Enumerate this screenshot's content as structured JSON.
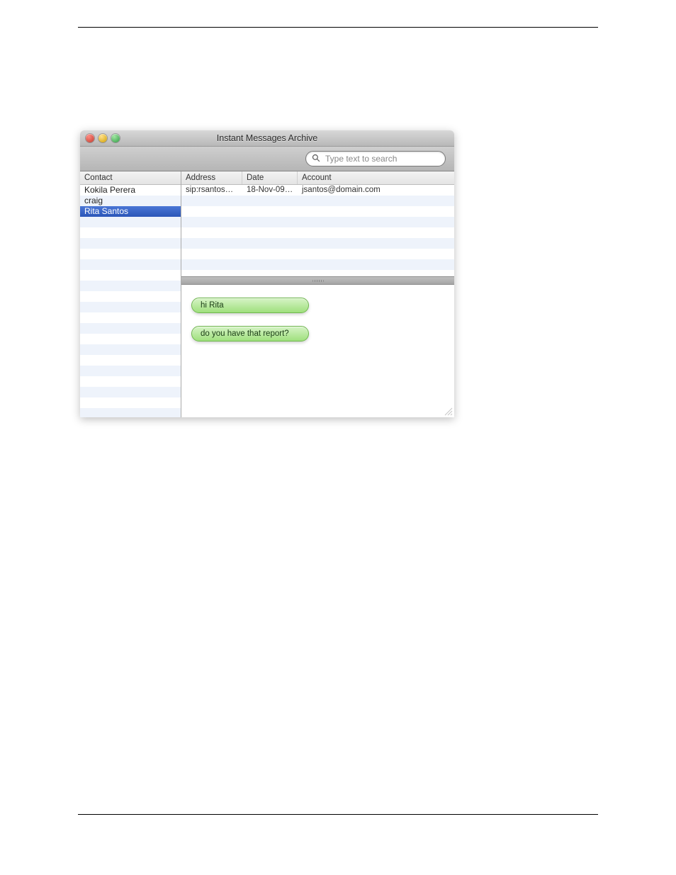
{
  "window": {
    "title": "Instant Messages Archive"
  },
  "search": {
    "placeholder": "Type text to search"
  },
  "sidebar": {
    "header": "Contact",
    "items": [
      {
        "label": "Kokila Perera",
        "selected": false
      },
      {
        "label": "craig",
        "selected": false
      },
      {
        "label": "Rita Santos",
        "selected": true
      }
    ]
  },
  "table": {
    "columns": {
      "address": "Address",
      "date": "Date",
      "account": "Account"
    },
    "rows": [
      {
        "address": "sip:rsantos@…",
        "date": "18-Nov-09 …",
        "account": "jsantos@domain.com"
      }
    ]
  },
  "messages": [
    {
      "text": "hi Rita"
    },
    {
      "text": "do you have that report?"
    }
  ]
}
